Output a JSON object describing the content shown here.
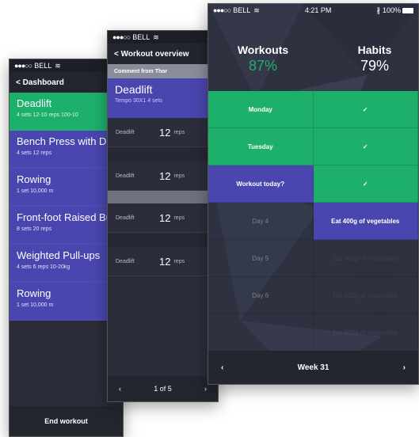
{
  "phone1": {
    "status": {
      "carrier": "BELL",
      "time": "4:"
    },
    "nav": {
      "back": "< Dashboard",
      "title": "D"
    },
    "exercises": [
      {
        "name": "Deadlift",
        "meta": "4 sets   12-10 reps   100-10"
      },
      {
        "name": "Bench Press with Du",
        "meta": "4 sets   12 reps"
      },
      {
        "name": "Rowing",
        "meta": "1 set   10,000 m"
      },
      {
        "name": "Front-foot Raised Bu",
        "meta": "8 sets   20 reps"
      },
      {
        "name": "Weighted Pull-ups",
        "meta": "4 sets   6 reps   10-20kg"
      },
      {
        "name": "Rowing",
        "meta": "1 set   10,000 m"
      }
    ],
    "end_label": "End workout"
  },
  "phone2": {
    "status": {
      "carrier": "BELL",
      "time": "4:"
    },
    "nav": {
      "back": "< Workout overview"
    },
    "comment": "Comment from Thor",
    "exercise": {
      "name": "Deadlift",
      "meta": "Tempo 30X1   4 sets"
    },
    "sets": [
      {
        "label": "Deadlift",
        "value": "12",
        "unit": "reps"
      },
      {
        "label": "Deadlift",
        "value": "12",
        "unit": "reps"
      },
      {
        "label": "Deadlift",
        "value": "12",
        "unit": "reps"
      },
      {
        "label": "Deadlift",
        "value": "12",
        "unit": "reps"
      }
    ],
    "pager": {
      "prev": "‹",
      "label": "1 of 5",
      "next": "›"
    }
  },
  "phone3": {
    "status": {
      "carrier": "BELL",
      "time": "4:21 PM",
      "battery": "100%"
    },
    "workouts": {
      "title": "Workouts",
      "percent": "87%"
    },
    "habits": {
      "title": "Habits",
      "percent": "79%"
    },
    "rows": [
      {
        "left": "Monday",
        "right": "✓"
      },
      {
        "left": "Tuesday",
        "right": "✓"
      },
      {
        "left": "Workout today?",
        "right": "✓"
      },
      {
        "left": "Day 4",
        "right": "Eat 400g of vegetables"
      },
      {
        "left": "Day 5",
        "right": "Eat 400g of vegetables"
      },
      {
        "left": "Day 6",
        "right": "Eat 400g of vegetables"
      },
      {
        "left": "",
        "right": "Eat 400g of vegetables"
      }
    ],
    "week": {
      "prev": "‹",
      "label": "Week 31",
      "next": "›"
    }
  },
  "colors": {
    "green": "#1db06a",
    "purple": "#4a46b0",
    "dark": "#23252f"
  }
}
